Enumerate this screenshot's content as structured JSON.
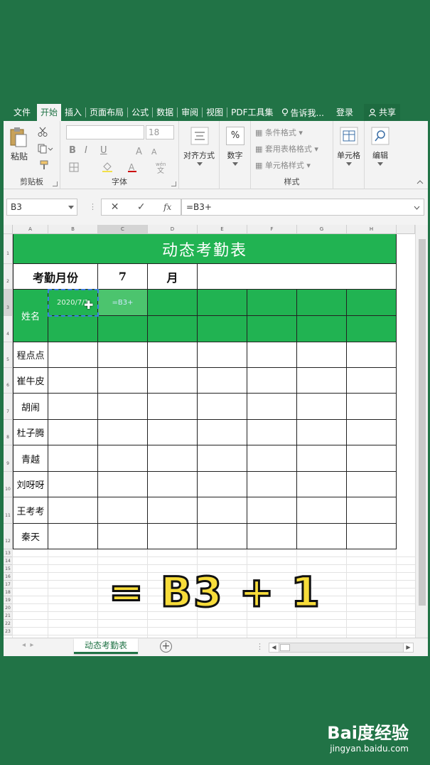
{
  "ribbon_tabs": [
    "文件",
    "开始",
    "插入",
    "页面布局",
    "公式",
    "数据",
    "审阅",
    "视图",
    "PDF工具集"
  ],
  "active_tab": "开始",
  "tell_me": "告诉我...",
  "login": "登录",
  "share": "共享",
  "clipboard": {
    "paste": "粘贴",
    "group_label": "剪贴板"
  },
  "font": {
    "font_size": "18",
    "group_label": "字体",
    "bold": "B",
    "italic": "I",
    "underline": "U",
    "phonetic": "wén\n文"
  },
  "alignment": {
    "label": "对齐方式"
  },
  "number": {
    "label": "数字",
    "symbol": "%"
  },
  "styles": {
    "conditional": "条件格式",
    "table_format": "套用表格格式",
    "cell_styles": "单元格样式",
    "group_label": "样式"
  },
  "cells": {
    "label": "单元格"
  },
  "editing": {
    "label": "编辑"
  },
  "formula_bar": {
    "name_box": "B3",
    "formula": "=B3+",
    "fx": "fx"
  },
  "columns": [
    "A",
    "B",
    "C",
    "D",
    "E",
    "F",
    "G",
    "H"
  ],
  "rows": [
    "1",
    "2",
    "3",
    "4",
    "5",
    "6",
    "7",
    "8",
    "9",
    "10",
    "11",
    "12",
    "13",
    "14",
    "15",
    "16",
    "17",
    "18",
    "19",
    "20",
    "21",
    "22",
    "23"
  ],
  "sheet": {
    "title": "动态考勤表",
    "month_label": "考勤月份",
    "month_value": "7",
    "month_unit": "月",
    "name_header": "姓名",
    "date_cell": "2020/7/1",
    "editing_cell": "=B3+",
    "names": [
      "程点点",
      "崔牛皮",
      "胡闹",
      "杜子腾",
      "青越",
      "刘呀呀",
      "王考考",
      "秦天"
    ]
  },
  "sheet_tab": "动态考勤表",
  "overlay_text": "= B3 + 1",
  "watermark": {
    "brand": "Bai度经验",
    "url": "jingyan.baidu.com"
  },
  "colors": {
    "excel_green": "#217346",
    "fill_green": "#21b352",
    "overlay_yellow": "#f7dc3a"
  }
}
